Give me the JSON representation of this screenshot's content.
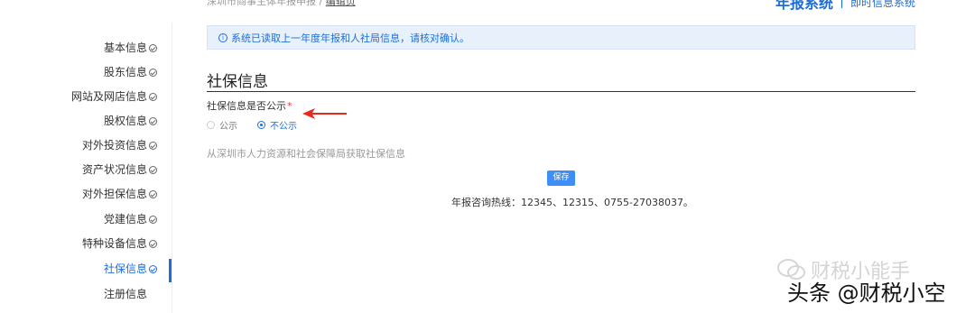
{
  "breadcrumb": {
    "parent": "深圳市商事主体年报申报",
    "separator": "/",
    "current": "编辑页"
  },
  "header": {
    "system_title": "年报系统",
    "system_link": "即时信息系统"
  },
  "sidebar": {
    "items": [
      {
        "label": "基本信息"
      },
      {
        "label": "股东信息"
      },
      {
        "label": "网站及网店信息"
      },
      {
        "label": "股权信息"
      },
      {
        "label": "对外投资信息"
      },
      {
        "label": "资产状况信息"
      },
      {
        "label": "对外担保信息"
      },
      {
        "label": "党建信息"
      },
      {
        "label": "特种设备信息"
      },
      {
        "label": "社保信息"
      },
      {
        "label": "注册信息"
      }
    ],
    "active_index": 9
  },
  "alert": {
    "text": "系统已读取上一年度年报和人社局信息，请核对确认。"
  },
  "section": {
    "title": "社保信息",
    "field_label": "社保信息是否公示",
    "required_mark": "*",
    "options": [
      {
        "label": "公示",
        "checked": false
      },
      {
        "label": "不公示",
        "checked": true
      }
    ],
    "source_text": "从深圳市人力资源和社会保障局获取社保信息"
  },
  "actions": {
    "save_label": "保存"
  },
  "footer": {
    "hotline": "年报咨询热线：12345、12315、0755-27038037。"
  },
  "watermark": {
    "top": "财税小能手",
    "bottom": "头条 @财税小空"
  },
  "colors": {
    "accent": "#1c6ed6",
    "button": "#3e8ef7",
    "annotation_arrow": "#e52a1f",
    "required": "#e23c3c"
  }
}
